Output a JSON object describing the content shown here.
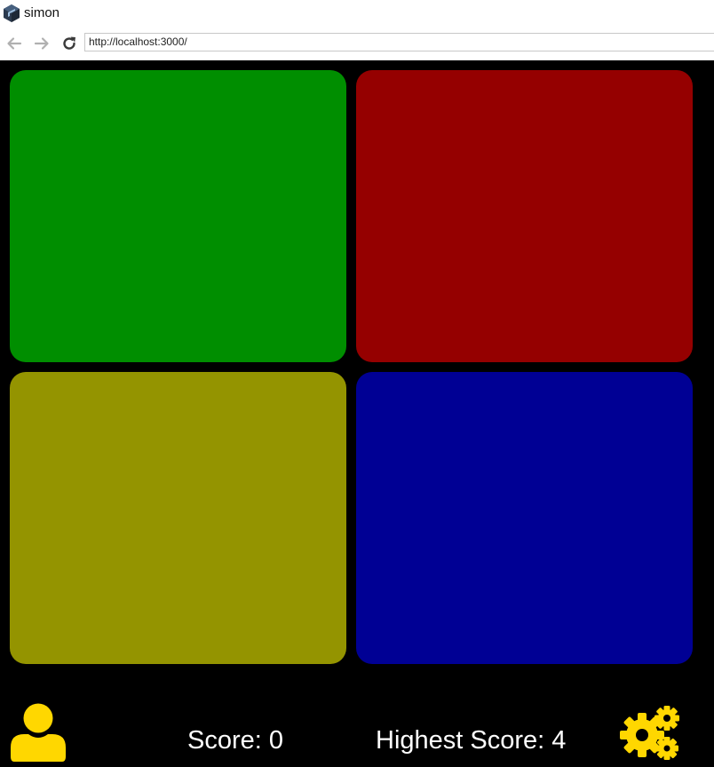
{
  "window": {
    "title": "simon"
  },
  "nav": {
    "url": "http://localhost:3000/"
  },
  "game": {
    "pads": [
      {
        "name": "green",
        "color": "#008e00"
      },
      {
        "name": "red",
        "color": "#950000"
      },
      {
        "name": "yellow",
        "color": "#949400"
      },
      {
        "name": "blue",
        "color": "#000094"
      }
    ],
    "score_text": "Score: 0",
    "high_score_text": "Highest Score: 4",
    "score": 0,
    "high_score": 4,
    "accent_color": "#ffd700",
    "icons": {
      "user": "user-icon",
      "settings": "gears-icon"
    }
  }
}
